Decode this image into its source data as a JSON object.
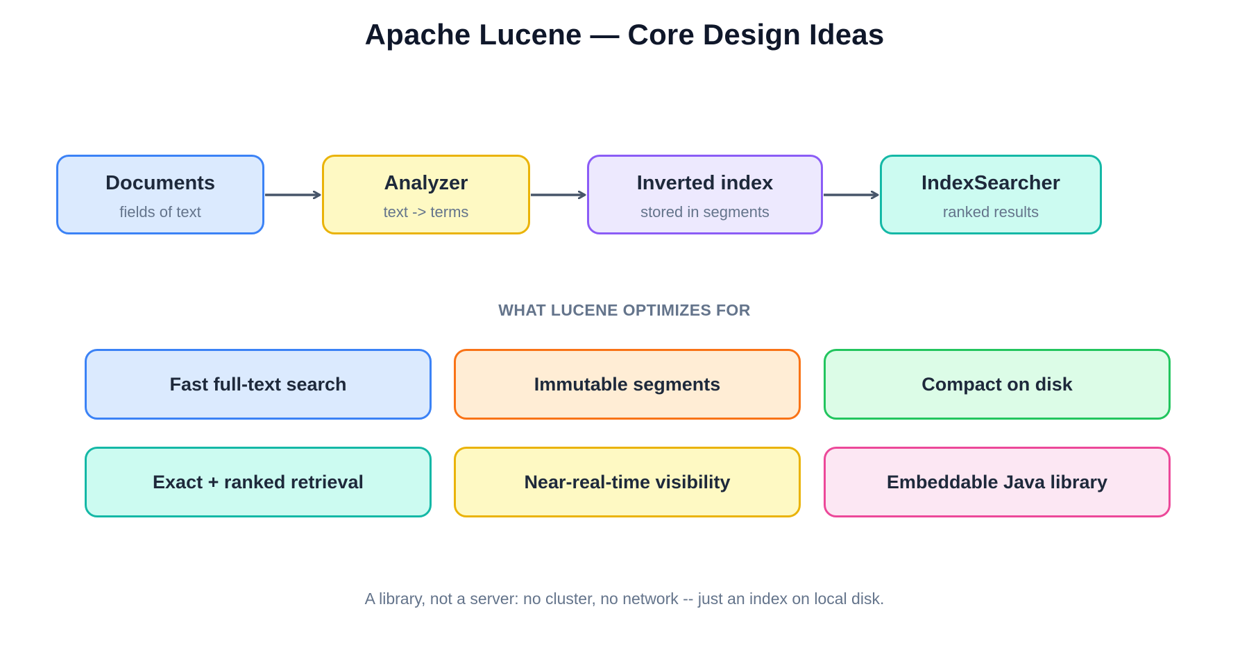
{
  "title": "Apache Lucene — Core Design Ideas",
  "pipeline": [
    {
      "label": "Documents",
      "sublabel": "fields of text"
    },
    {
      "label": "Analyzer",
      "sublabel": "text -> terms"
    },
    {
      "label": "Inverted index",
      "sublabel": "stored in segments"
    },
    {
      "label": "IndexSearcher",
      "sublabel": "ranked results"
    }
  ],
  "section_heading": "WHAT LUCENE OPTIMIZES FOR",
  "features": [
    "Fast full-text search",
    "Immutable segments",
    "Compact on disk",
    "Exact + ranked retrieval",
    "Near-real-time visibility",
    "Embeddable Java library"
  ],
  "footer": "A library, not a server: no cluster, no network -- just an index on local disk.",
  "colors": {
    "arrow": "#475569",
    "documents": "#3b82f6",
    "analyzer": "#eab308",
    "inverted_index": "#8b5cf6",
    "index_searcher": "#14b8a6"
  }
}
